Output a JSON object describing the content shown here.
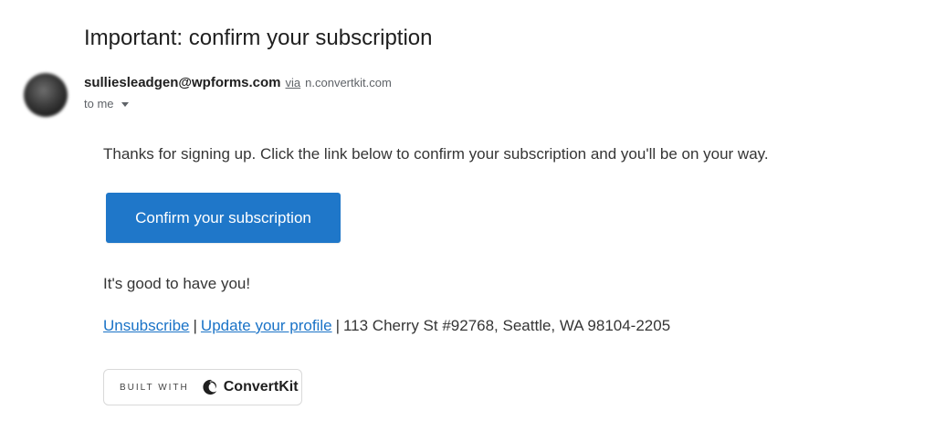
{
  "email": {
    "subject": "Important: confirm your subscription",
    "sender": {
      "email": "sulliesleadgen@wpforms.com",
      "via_label": "via",
      "via_domain": "n.convertkit.com"
    },
    "recipient_label": "to me"
  },
  "message": {
    "intro": "Thanks for signing up. Click the link below to confirm your subscription and you'll be on your way.",
    "confirm_button_label": "Confirm your subscription",
    "closing": "It's good to have you!",
    "footer": {
      "unsubscribe_label": "Unsubscribe",
      "separator": "|",
      "update_profile_label": "Update your profile",
      "address": "113 Cherry St #92768, Seattle, WA 98104-2205"
    },
    "badge": {
      "built_with_label": "BUILT WITH",
      "brand_name": "ConvertKit"
    }
  },
  "colors": {
    "button_bg": "#1f77c9",
    "link": "#1a73c7"
  },
  "icons": {
    "sender_avatar": "avatar",
    "recipient_dropdown": "caret-down-icon",
    "brand_logo": "convertkit-logo-icon"
  }
}
